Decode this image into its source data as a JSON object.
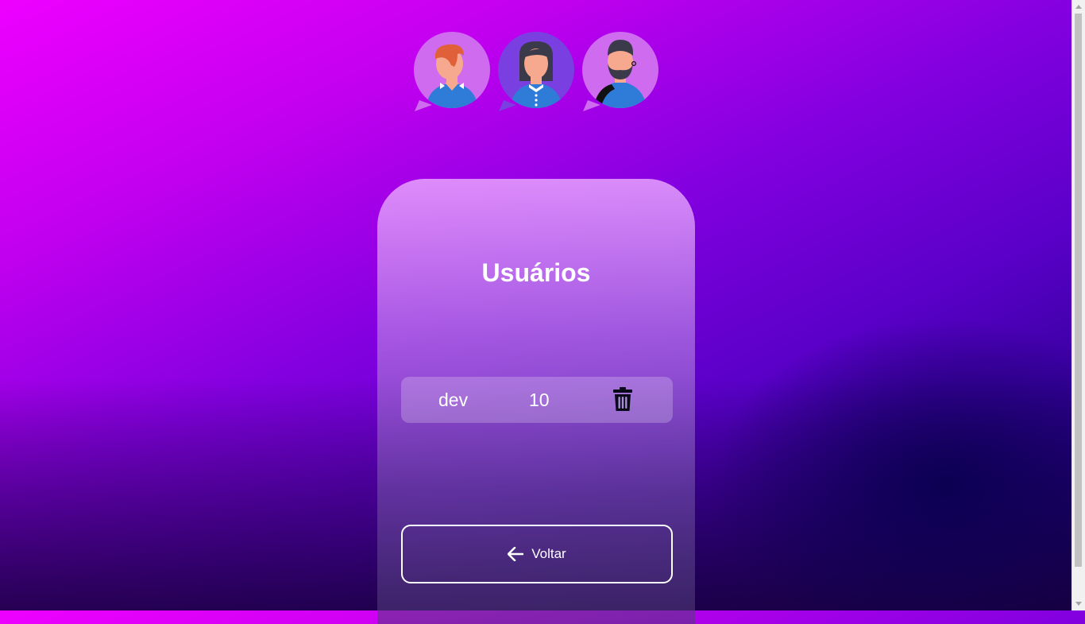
{
  "header": {
    "avatars": [
      {
        "name": "avatar-man-redhair",
        "icon": "man-redhair-icon"
      },
      {
        "name": "avatar-woman",
        "icon": "woman-icon"
      },
      {
        "name": "avatar-man-beard",
        "icon": "man-beard-icon"
      }
    ]
  },
  "main": {
    "title": "Usuários",
    "users": [
      {
        "name": "dev",
        "age": "10"
      }
    ],
    "back_label": "Voltar"
  },
  "colors": {
    "bg_top_left": "#ee00ff",
    "bg_bottom_right": "#10005a",
    "shirt": "#2f7cd8",
    "skin": "#f6a98e",
    "bubble_pink": "#cf6bef",
    "bubble_purple": "#7a3fe0"
  }
}
